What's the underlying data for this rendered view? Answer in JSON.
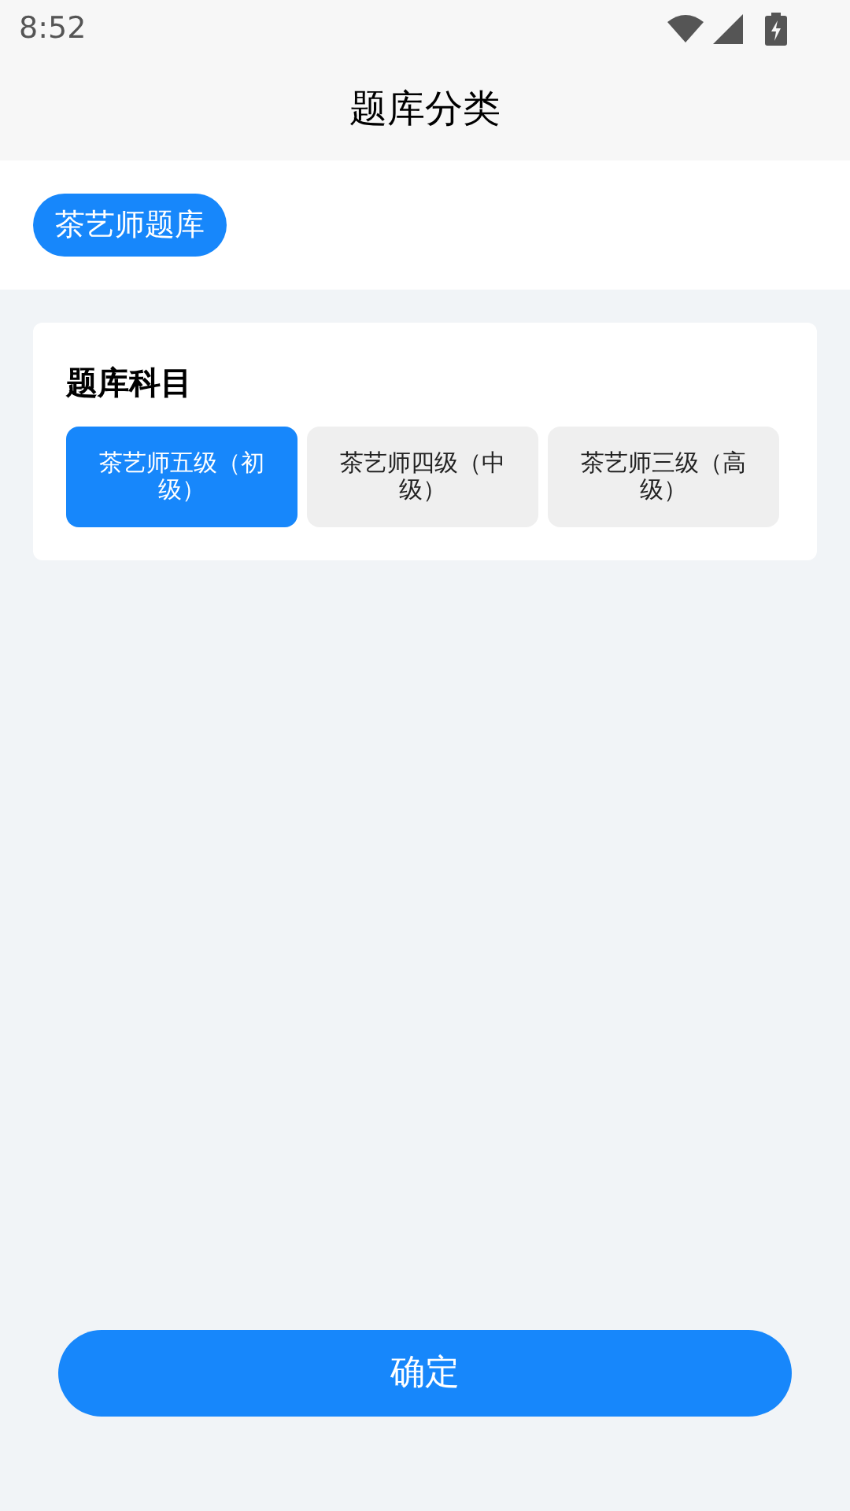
{
  "status_bar": {
    "time": "8:52"
  },
  "header": {
    "title": "题库分类"
  },
  "categories": [
    {
      "label": "茶艺师题库",
      "selected": true
    }
  ],
  "subjects": {
    "title": "题库科目",
    "options": [
      {
        "label": "茶艺师五级（初级）",
        "selected": true
      },
      {
        "label": "茶艺师四级（中级）",
        "selected": false
      },
      {
        "label": "茶艺师三级（高级）",
        "selected": false
      }
    ]
  },
  "confirm_button": {
    "label": "确定"
  }
}
